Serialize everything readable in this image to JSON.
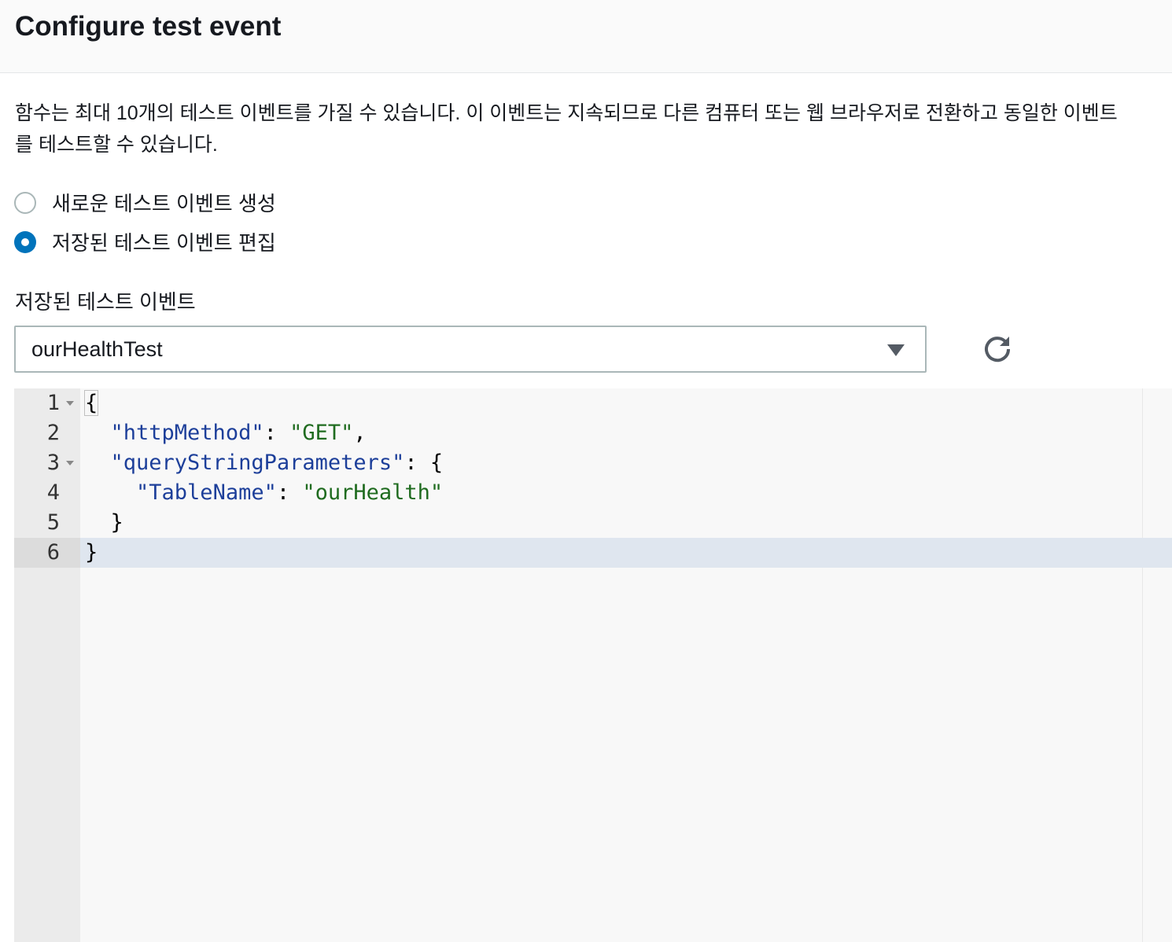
{
  "header": {
    "title": "Configure test event"
  },
  "description": {
    "line1": "함수는 최대 10개의 테스트 이벤트를 가질 수 있습니다. 이 이벤트는 지속되므로 다른 컴퓨터 또는 웹 브라우저로 전환하고 동일한 이벤트",
    "line2": "를 테스트할 수 있습니다."
  },
  "options": {
    "create_new": {
      "label": "새로운 테스트 이벤트 생성",
      "checked": false
    },
    "edit_saved": {
      "label": "저장된 테스트 이벤트 편집",
      "checked": true
    }
  },
  "saved_events": {
    "label": "저장된 테스트 이벤트",
    "selected": "ourHealthTest",
    "icons": {
      "dropdown": "caret-down-icon",
      "refresh": "refresh-icon"
    }
  },
  "editor": {
    "active_line": 6,
    "lines": [
      {
        "number": "1",
        "foldable": true
      },
      {
        "number": "2",
        "foldable": false
      },
      {
        "number": "3",
        "foldable": true
      },
      {
        "number": "4",
        "foldable": false
      },
      {
        "number": "5",
        "foldable": false
      },
      {
        "number": "6",
        "foldable": false
      }
    ],
    "tokens": {
      "l1_open": "{",
      "l2_key": "\"httpMethod\"",
      "l2_colon": ": ",
      "l2_value": "\"GET\"",
      "l2_comma": ",",
      "l3_key": "\"queryStringParameters\"",
      "l3_rest": ": {",
      "l4_key": "\"TableName\"",
      "l4_colon": ": ",
      "l4_value": "\"ourHealth\"",
      "l5_close": "}",
      "l6_close": "}"
    }
  },
  "colors": {
    "accent": "#0073bb",
    "json_key": "#1d3f9a",
    "json_string": "#1f6b1f",
    "active_line": "#dfe6ef"
  }
}
